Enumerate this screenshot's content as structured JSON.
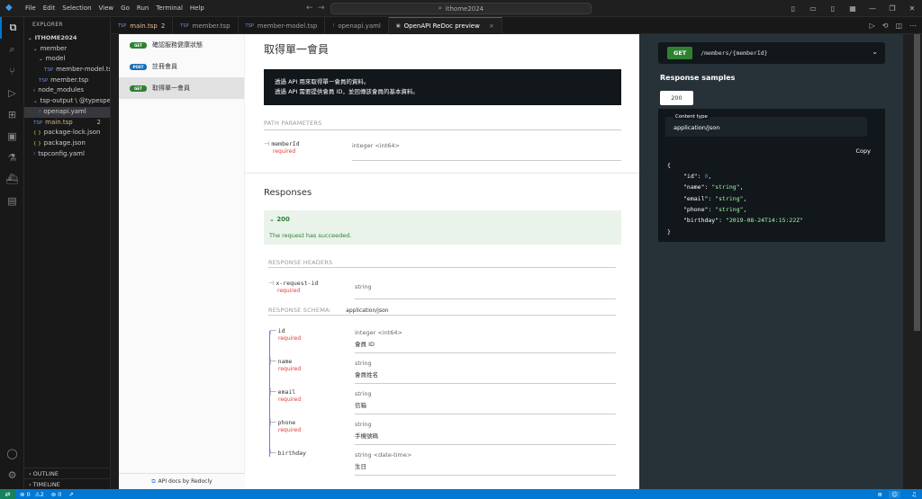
{
  "titlebar": {
    "menu": [
      "File",
      "Edit",
      "Selection",
      "View",
      "Go",
      "Run",
      "Terminal",
      "Help"
    ],
    "search": "ithome2024"
  },
  "sidebar": {
    "title": "EXPLORER",
    "workspace": "ITHOME2024",
    "items": [
      {
        "label": "member",
        "indent": 1,
        "type": "folder-open",
        "badge": ""
      },
      {
        "label": "model",
        "indent": 2,
        "type": "folder-open",
        "badge": ""
      },
      {
        "label": "member-model.tsp",
        "indent": 3,
        "type": "tsp",
        "badge": ""
      },
      {
        "label": "member.tsp",
        "indent": 2,
        "type": "tsp",
        "badge": ""
      },
      {
        "label": "node_modules",
        "indent": 1,
        "type": "folder",
        "badge": ""
      },
      {
        "label": "tsp-output \\ @typespec...",
        "indent": 1,
        "type": "folder-open",
        "badge": ""
      },
      {
        "label": "openapi.yaml",
        "indent": 2,
        "type": "yaml",
        "badge": ""
      },
      {
        "label": "main.tsp",
        "indent": 1,
        "type": "tsp",
        "badge": "2"
      },
      {
        "label": "package-lock.json",
        "indent": 1,
        "type": "json",
        "badge": ""
      },
      {
        "label": "package.json",
        "indent": 1,
        "type": "json",
        "badge": ""
      },
      {
        "label": "tspconfig.yaml",
        "indent": 1,
        "type": "yaml",
        "badge": ""
      }
    ],
    "outline": "OUTLINE",
    "timeline": "TIMELINE"
  },
  "tabs": [
    {
      "label": "main.tsp",
      "badge": "2",
      "icon": "TSP"
    },
    {
      "label": "member.tsp",
      "badge": "",
      "icon": "TSP"
    },
    {
      "label": "member-model.tsp",
      "badge": "",
      "icon": "TSP"
    },
    {
      "label": "openapi.yaml",
      "badge": "",
      "icon": "!"
    },
    {
      "label": "OpenAPI ReDoc preview",
      "badge": "",
      "icon": "▣"
    }
  ],
  "redoc_menu": {
    "items": [
      {
        "method": "GET",
        "label": "確認服務健康狀態"
      },
      {
        "method": "POST",
        "label": "註冊會員"
      },
      {
        "method": "GET",
        "label": "取得單一會員"
      }
    ],
    "footer": "API docs by Redocly"
  },
  "operation": {
    "title": "取得單一會員",
    "description_lines": [
      "透過 API 用來取得單一會員的資料。",
      "透過 API 需要提供會員 ID，並回傳該會員的基本資料。"
    ],
    "path_params_heading": "PATH PARAMETERS",
    "path_param": {
      "name": "memberId",
      "required": "required",
      "type": "integer <int64>"
    },
    "responses_heading": "Responses",
    "response_code": "200",
    "response_desc": "The request has succeeded.",
    "response_headers_heading": "RESPONSE HEADERS",
    "header_param": {
      "name": "x-request-id",
      "required": "required",
      "type": "string"
    },
    "response_schema_heading": "RESPONSE SCHEMA:",
    "schema_type": "application/json",
    "schema_fields": [
      {
        "name": "id",
        "required": "required",
        "type": "integer <int64>",
        "desc": "會員 ID"
      },
      {
        "name": "name",
        "required": "required",
        "type": "string",
        "desc": "會員姓名"
      },
      {
        "name": "email",
        "required": "required",
        "type": "string",
        "desc": "信箱"
      },
      {
        "name": "phone",
        "required": "required",
        "type": "string",
        "desc": "手機號碼"
      },
      {
        "name": "birthday",
        "required": "",
        "type": "string <date-time>",
        "desc": "生日"
      }
    ]
  },
  "right_panel": {
    "method": "GET",
    "path": "/members/{memberId}",
    "samples_title": "Response samples",
    "sample_code": "200",
    "content_type_label": "Content type",
    "content_type": "application/json",
    "copy": "Copy",
    "json_open": "{",
    "json_close": "}",
    "json_lines": [
      {
        "key": "\"id\"",
        "value": "0",
        "kind": "n",
        "comma": ","
      },
      {
        "key": "\"name\"",
        "value": "\"string\"",
        "kind": "s",
        "comma": ","
      },
      {
        "key": "\"email\"",
        "value": "\"string\"",
        "kind": "s",
        "comma": ","
      },
      {
        "key": "\"phone\"",
        "value": "\"string\"",
        "kind": "s",
        "comma": ","
      },
      {
        "key": "\"birthday\"",
        "value": "\"2019-08-24T14:15:22Z\"",
        "kind": "s",
        "comma": ""
      }
    ]
  },
  "statusbar": {
    "errors": "0",
    "warnings": "2",
    "ports": "0"
  },
  "colors": {
    "accent": "#0078d4",
    "get": "#2f8132",
    "post": "#186fb5",
    "required": "#e53935"
  }
}
